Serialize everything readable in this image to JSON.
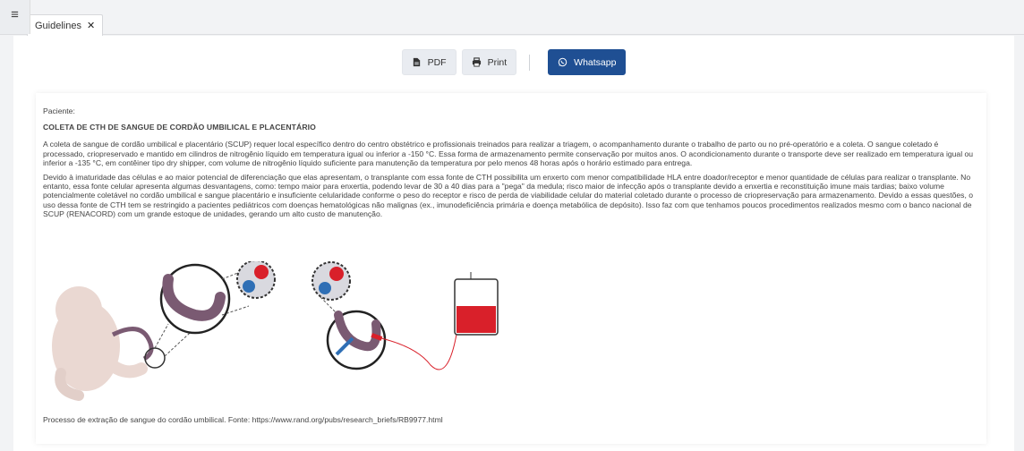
{
  "tab": {
    "label": "Guidelines",
    "close": "✕"
  },
  "toolbar": {
    "pdf_label": "PDF",
    "print_label": "Print",
    "whatsapp_label": "Whatsapp"
  },
  "document": {
    "patient_label": "Paciente:",
    "title": "COLETA DE CTH DE SANGUE DE CORDÃO UMBILICAL E PLACENTÁRIO",
    "paragraph1": "A coleta de sangue de cordão umbilical e placentário (SCUP) requer local específico dentro do centro obstétrico e profissionais treinados para realizar a triagem, o acompanhamento durante o trabalho de parto ou no pré-operatório e a coleta. O sangue coletado é processado, criopreservado e mantido em cilindros de nitrogênio líquido em temperatura igual ou inferior a -150 °C. Essa forma de armazenamento permite conservação por muitos anos. O acondicionamento durante o transporte deve ser realizado em temperatura igual ou inferior a -135 °C, em contêiner tipo dry shipper, com volume de nitrogênio líquido suficiente para manutenção da temperatura por pelo menos 48 horas após o horário estimado para entrega.",
    "paragraph2": "Devido à imaturidade das células e ao maior potencial de diferenciação que elas apresentam, o transplante com essa fonte de CTH possibilita um enxerto com menor compatibilidade HLA entre doador/receptor e menor quantidade de células para realizar o transplante. No entanto, essa fonte celular apresenta algumas desvantagens, como: tempo maior para enxertia, podendo levar de 30 a 40 dias para a \"pega\" da medula; risco maior de infecção após o transplante devido a enxertia e reconstituição imune mais tardias; baixo volume potencialmente coletável no cordão umbilical e sangue placentário e insuficiente celularidade conforme o peso do receptor e risco de perda de viabilidade celular do material coletado durante o processo de criopreservação para armazenamento. Devido a essas questões, o uso dessa fonte de CTH tem se restringido a pacientes pediátricos com doenças hematológicas não malignas (ex., imunodeficiência primária e doença metabólica de depósito). Isso faz com que tenhamos poucos procedimentos realizados mesmo com o banco nacional de SCUP (RENACORD) com um grande estoque de unidades, gerando um alto custo de manutenção.",
    "caption": "Processo de extração de sangue do cordão umbilical. Fonte: https://www.rand.org/pubs/research_briefs/RB9977.html"
  },
  "icons": {
    "menu": "hamburger-icon",
    "pdf": "pdf-file-icon",
    "print": "printer-icon",
    "whatsapp": "whatsapp-icon"
  },
  "colors": {
    "accent": "#1f4f93",
    "blood_red": "#d9202a",
    "cord_purple": "#7a5a72",
    "cell_blue": "#2f6fb5"
  }
}
